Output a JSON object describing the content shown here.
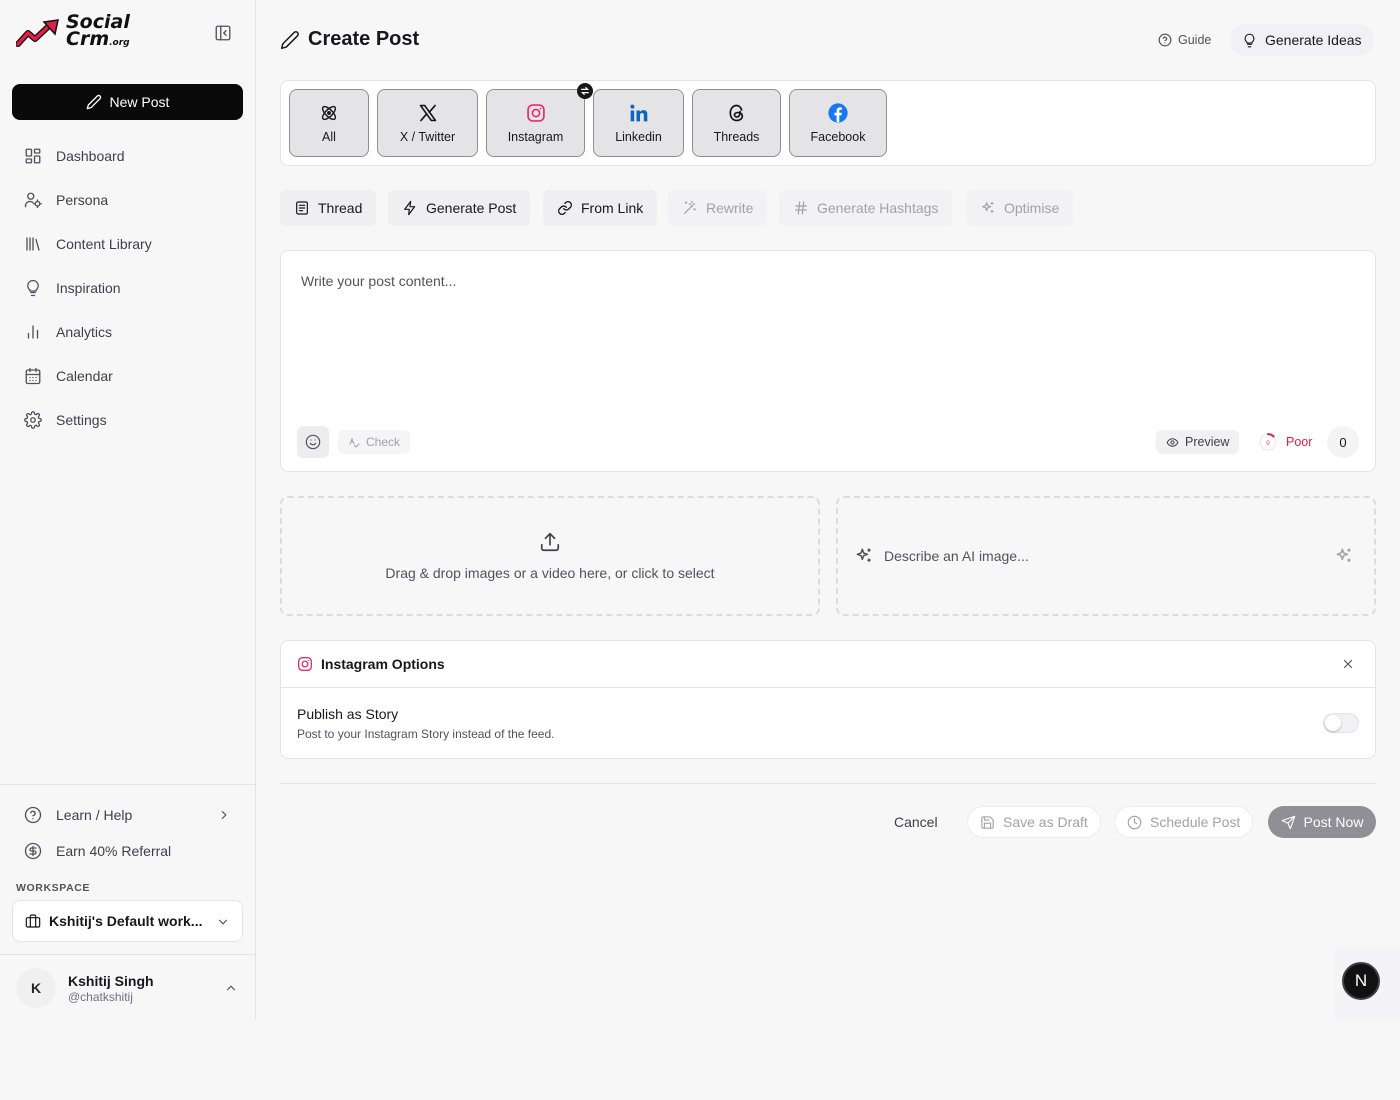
{
  "brand": {
    "logo_line1": "Social",
    "logo_line2": "Crm",
    "logo_suffix": ".org",
    "accent": "#e11d48"
  },
  "sidebar": {
    "new_post_label": "New Post",
    "items": [
      {
        "label": "Dashboard",
        "icon": "dashboard-icon"
      },
      {
        "label": "Persona",
        "icon": "persona-icon"
      },
      {
        "label": "Content Library",
        "icon": "library-icon"
      },
      {
        "label": "Inspiration",
        "icon": "lightbulb-icon"
      },
      {
        "label": "Analytics",
        "icon": "analytics-icon"
      },
      {
        "label": "Calendar",
        "icon": "calendar-icon"
      },
      {
        "label": "Settings",
        "icon": "gear-icon"
      }
    ],
    "learn_help": "Learn / Help",
    "referral": "Earn 40% Referral",
    "workspace_label": "WORKSPACE",
    "workspace_name": "Kshitij's Default work...",
    "user": {
      "initial": "K",
      "name": "Kshitij Singh",
      "handle": "@chatkshitij"
    }
  },
  "header": {
    "title": "Create Post",
    "guide_label": "Guide",
    "generate_ideas_label": "Generate Ideas"
  },
  "platforms": [
    {
      "label": "All",
      "icon": "atom-icon"
    },
    {
      "label": "X / Twitter",
      "icon": "x-icon"
    },
    {
      "label": "Instagram",
      "icon": "instagram-icon",
      "color": "#e1306c"
    },
    {
      "label": "Linkedin",
      "icon": "linkedin-icon",
      "color": "#0a66c2"
    },
    {
      "label": "Threads",
      "icon": "threads-icon"
    },
    {
      "label": "Facebook",
      "icon": "facebook-icon",
      "color": "#1877f2"
    }
  ],
  "tools": {
    "thread": "Thread",
    "generate_post": "Generate Post",
    "from_link": "From Link",
    "rewrite": "Rewrite",
    "generate_hashtags": "Generate Hashtags",
    "optimise": "Optimise"
  },
  "editor": {
    "placeholder": "Write your post content...",
    "check_label": "Check",
    "preview_label": "Preview",
    "score_label": "Poor",
    "char_count": "0"
  },
  "media": {
    "dropzone_text": "Drag & drop images or a video here, or click to select",
    "ai_image_placeholder": "Describe an AI image..."
  },
  "instagram_options": {
    "title": "Instagram Options",
    "story_title": "Publish as Story",
    "story_desc": "Post to your Instagram Story instead of the feed.",
    "story_enabled": false
  },
  "footer": {
    "cancel": "Cancel",
    "save_draft": "Save as Draft",
    "schedule": "Schedule Post",
    "post_now": "Post Now"
  },
  "dev_badge": "N"
}
